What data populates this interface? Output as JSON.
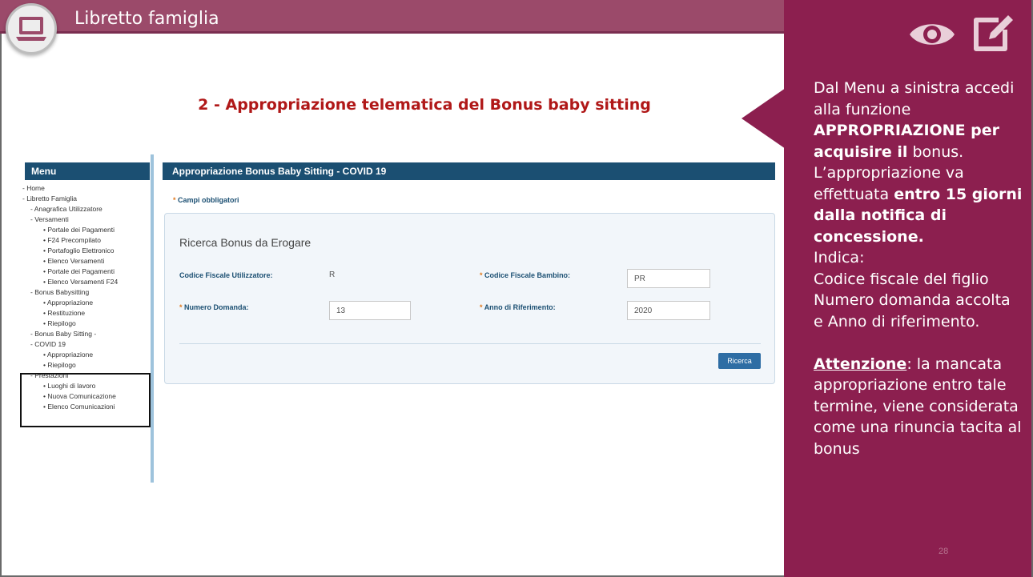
{
  "header": {
    "title": "Libretto famiglia",
    "slide_heading": "2 - Appropriazione telematica del Bonus baby sitting"
  },
  "side_panel": {
    "line1": "Dal Menu a sinistra accedi alla funzione",
    "bold1": "APPROPRIAZIONE per acquisire il",
    "line2": "bonus. L’appropriazione va effettuata",
    "bold2": "entro 15 giorni dalla notifica di concessione.",
    "line3": "Indica:",
    "line4": "Codice fiscale del figlio",
    "line5": "Numero domanda accolta e Anno di riferimento.",
    "warning_label": "Attenzione",
    "warning_text": ": la mancata appropriazione entro tale termine, viene considerata come una rinuncia tacita al bonus",
    "page_number": "28",
    "icons": [
      "eye-icon",
      "edit-icon"
    ],
    "color": "#8c1f4f"
  },
  "screenshot": {
    "menu": {
      "title": "Menu",
      "items": [
        {
          "label": "Home",
          "level": 1
        },
        {
          "label": "Libretto Famiglia",
          "level": 1
        },
        {
          "label": "Anagrafica Utilizzatore",
          "level": 2
        },
        {
          "label": "Versamenti",
          "level": 2
        },
        {
          "label": "Portale dei Pagamenti",
          "level": 3
        },
        {
          "label": "F24 Precompilato",
          "level": 3
        },
        {
          "label": "Portafoglio Elettronico",
          "level": 3
        },
        {
          "label": "Elenco Versamenti",
          "level": 3
        },
        {
          "label": "Portale dei Pagamenti",
          "level": 3
        },
        {
          "label": "Elenco Versamenti F24",
          "level": 3
        },
        {
          "label": "Bonus Babysitting",
          "level": 2
        },
        {
          "label": "Appropriazione",
          "level": 3
        },
        {
          "label": "Restituzione",
          "level": 3
        },
        {
          "label": "Riepilogo",
          "level": 3
        },
        {
          "label": "Bonus Baby Sitting -",
          "level": 2
        },
        {
          "label": "COVID 19",
          "level": 2
        },
        {
          "label": "Appropriazione",
          "level": 3
        },
        {
          "label": "Riepilogo",
          "level": 3
        },
        {
          "label": "Prestazioni",
          "level": 2
        },
        {
          "label": "Luoghi di lavoro",
          "level": 3
        },
        {
          "label": "Nuova Comunicazione",
          "level": 3
        },
        {
          "label": "Elenco Comunicazioni",
          "level": 3
        }
      ]
    },
    "panel_title": "Appropriazione Bonus Baby Sitting - COVID 19",
    "required_note": "Campi obbligatori",
    "form": {
      "title": "Ricerca Bonus da Erogare",
      "codice_fiscale_utilizzatore_label": "Codice Fiscale Utilizzatore:",
      "codice_fiscale_utilizzatore_value": "R",
      "codice_fiscale_bambino_label": "Codice Fiscale Bambino:",
      "codice_fiscale_bambino_value": "PR",
      "numero_domanda_label": "Numero Domanda:",
      "numero_domanda_value": "13",
      "anno_label": "Anno di Riferimento:",
      "anno_value": "2020",
      "search_button": "Ricerca"
    }
  }
}
